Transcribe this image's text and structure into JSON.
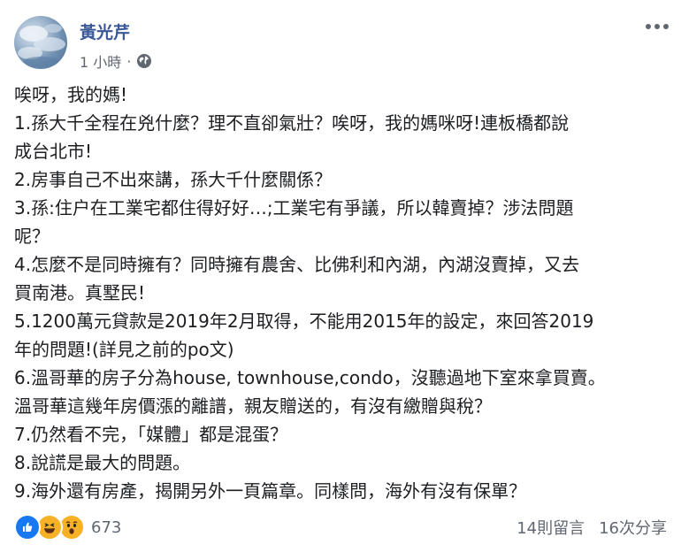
{
  "post": {
    "author": "黃光芹",
    "timestamp": "1 小時",
    "separator": "·",
    "body_lines": [
      "唉呀，我的媽!",
      "1.孫大千全程在兇什麼？理不直卻氣壯？唉呀，我的媽咪呀!連板橋都說",
      "成台北市!",
      "2.房事自己不出來講，孫大千什麼關係？",
      "3.孫:住户在工業宅都住得好好…;工業宅有爭議，所以韓賣掉？涉法問題",
      "呢？",
      "4.怎麼不是同時擁有？同時擁有農舍、比佛利和內湖，內湖沒賣掉，又去",
      "買南港。真墅民!",
      "5.1200萬元貸款是2019年2月取得，不能用2015年的設定，來回答2019",
      "年的問題!(詳見之前的po文)",
      "6.溫哥華的房子分為house, townhouse,condo，沒聽過地下室來拿買賣。",
      "溫哥華這幾年房價漲的離譜，親友贈送的，有沒有繳贈與稅？",
      "7.仍然看不完，「媒體」都是混蛋？",
      "8.說謊是最大的問題。",
      "9.海外還有房產，揭開另外一頁篇章。同樣問，海外有沒有保單？"
    ]
  },
  "footer": {
    "reaction_count": "673",
    "comments": "14則留言",
    "shares": "16次分享"
  },
  "icons": {
    "more": "more-options-icon",
    "privacy": "globe-icon",
    "reactions": [
      "like-icon",
      "haha-icon",
      "wow-icon"
    ]
  },
  "colors": {
    "author": "#385898",
    "like": "#1877f2",
    "haha": "#f7b125",
    "muted": "#606770"
  }
}
